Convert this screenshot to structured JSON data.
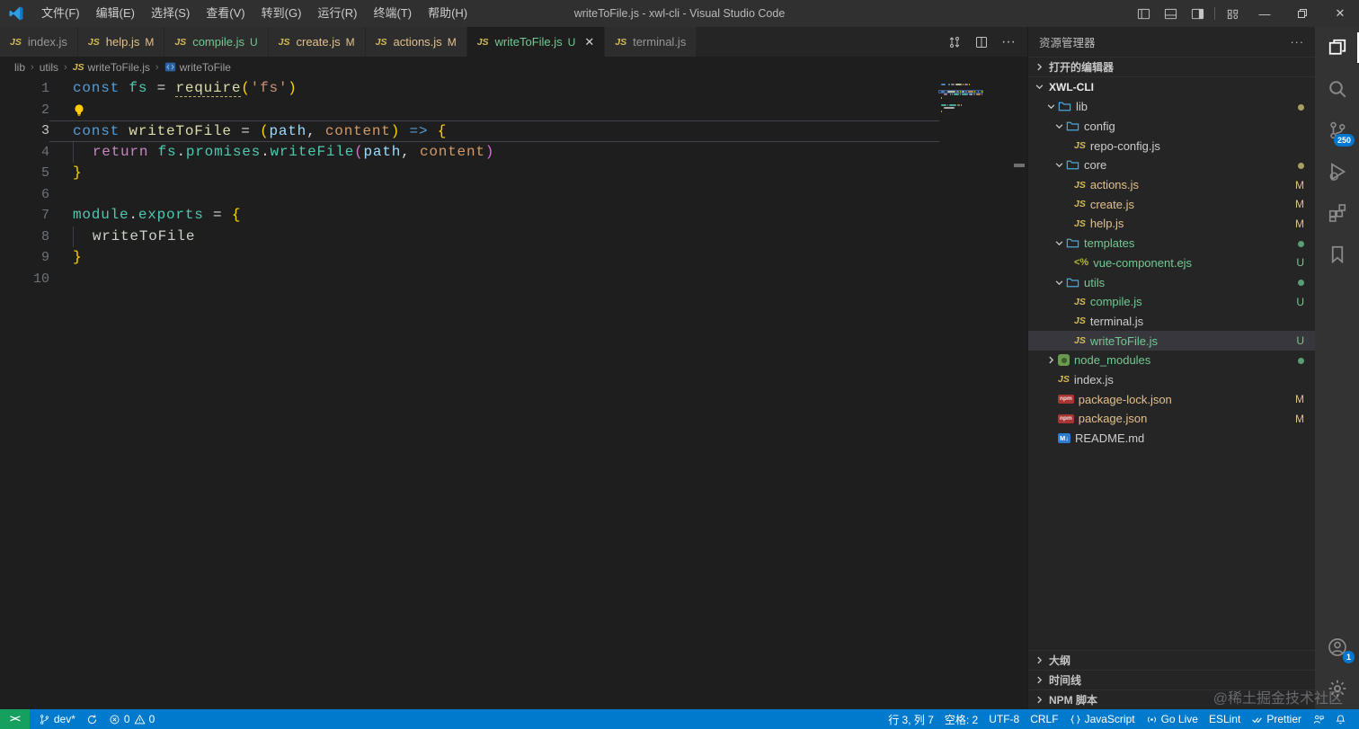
{
  "titlebar": {
    "title": "writeToFile.js - xwl-cli - Visual Studio Code",
    "menus": [
      "文件(F)",
      "编辑(E)",
      "选择(S)",
      "查看(V)",
      "转到(G)",
      "运行(R)",
      "终端(T)",
      "帮助(H)"
    ],
    "layout_icons": [
      "layout-sidebar-left-icon",
      "layout-panel-icon",
      "layout-sidebar-right-icon"
    ],
    "customize_icon": "customize-layout-icon",
    "window_buttons": [
      "minimize",
      "restore",
      "close"
    ]
  },
  "tabs": [
    {
      "label": "index.js",
      "badge": "",
      "state": "default",
      "active": false
    },
    {
      "label": "help.js",
      "badge": "M",
      "state": "modified",
      "active": false
    },
    {
      "label": "compile.js",
      "badge": "U",
      "state": "untracked",
      "active": false
    },
    {
      "label": "create.js",
      "badge": "M",
      "state": "modified",
      "active": false
    },
    {
      "label": "actions.js",
      "badge": "M",
      "state": "modified",
      "active": false
    },
    {
      "label": "writeToFile.js",
      "badge": "U",
      "state": "untracked",
      "active": true
    },
    {
      "label": "terminal.js",
      "badge": "",
      "state": "default",
      "active": false
    }
  ],
  "tab_actions": [
    "open-changes-icon",
    "split-editor-icon",
    "more-actions-icon"
  ],
  "breadcrumb": {
    "path": [
      "lib",
      "utils"
    ],
    "file": "writeToFile.js",
    "symbol": "writeToFile"
  },
  "editor": {
    "current_line": 3,
    "lightbulb_line": 2,
    "lines": [
      {
        "tokens": [
          [
            "const",
            "kw"
          ],
          [
            " ",
            "ws"
          ],
          [
            "fs",
            "var"
          ],
          [
            " = ",
            "op"
          ],
          [
            "require",
            "fnu"
          ],
          [
            "(",
            "b1"
          ],
          [
            "'fs'",
            "str"
          ],
          [
            ")",
            "b1"
          ]
        ]
      },
      {
        "tokens": []
      },
      {
        "tokens": [
          [
            "const",
            "kw"
          ],
          [
            " ",
            "ws"
          ],
          [
            "writeToFile",
            "fn"
          ],
          [
            " = ",
            "op"
          ],
          [
            "(",
            "b1"
          ],
          [
            "path",
            "p1"
          ],
          [
            ", ",
            "op"
          ],
          [
            "content",
            "p2"
          ],
          [
            ")",
            "b1"
          ],
          [
            " ",
            "ws"
          ],
          [
            "=>",
            "kw"
          ],
          [
            " ",
            "ws"
          ],
          [
            "{",
            "b1"
          ]
        ]
      },
      {
        "tokens": [
          [
            "  ",
            "ind"
          ],
          [
            "return",
            "ctrl"
          ],
          [
            " ",
            "ws"
          ],
          [
            "fs",
            "var"
          ],
          [
            ".",
            "op"
          ],
          [
            "promises",
            "var"
          ],
          [
            ".",
            "op"
          ],
          [
            "writeFile",
            "var"
          ],
          [
            "(",
            "b2"
          ],
          [
            "path",
            "p1"
          ],
          [
            ", ",
            "op"
          ],
          [
            "content",
            "p2"
          ],
          [
            ")",
            "b2"
          ]
        ]
      },
      {
        "tokens": [
          [
            "}",
            "b1"
          ]
        ]
      },
      {
        "tokens": []
      },
      {
        "tokens": [
          [
            "module",
            "var"
          ],
          [
            ".",
            "op"
          ],
          [
            "exports",
            "var"
          ],
          [
            " = ",
            "op"
          ],
          [
            "{",
            "b1"
          ]
        ]
      },
      {
        "tokens": [
          [
            "  ",
            "ind"
          ],
          [
            "writeToFile",
            "plain"
          ]
        ]
      },
      {
        "tokens": [
          [
            "}",
            "b1"
          ]
        ]
      },
      {
        "tokens": []
      }
    ]
  },
  "explorer": {
    "title": "资源管理器",
    "open_editors_label": "打开的编辑器",
    "project_label": "XWL-CLI",
    "tree": [
      {
        "name": "lib",
        "icon": "folder",
        "level": 1,
        "chevron": "down",
        "color": "default",
        "dot": "#a8a060"
      },
      {
        "name": "config",
        "icon": "folder",
        "level": 2,
        "chevron": "down",
        "color": "default"
      },
      {
        "name": "repo-config.js",
        "icon": "js",
        "level": 3,
        "color": "default"
      },
      {
        "name": "core",
        "icon": "folder",
        "level": 2,
        "chevron": "down",
        "color": "default",
        "dot": "#a8a060"
      },
      {
        "name": "actions.js",
        "icon": "js",
        "level": 3,
        "color": "mod",
        "badge": "M"
      },
      {
        "name": "create.js",
        "icon": "js",
        "level": 3,
        "color": "mod",
        "badge": "M"
      },
      {
        "name": "help.js",
        "icon": "js",
        "level": 3,
        "color": "mod",
        "badge": "M"
      },
      {
        "name": "templates",
        "icon": "folder",
        "level": 2,
        "chevron": "down",
        "color": "green",
        "dot": "#5a9e76"
      },
      {
        "name": "vue-component.ejs",
        "icon": "ejs",
        "level": 3,
        "color": "green",
        "badge": "U"
      },
      {
        "name": "utils",
        "icon": "folder",
        "level": 2,
        "chevron": "down",
        "color": "green",
        "dot": "#5a9e76"
      },
      {
        "name": "compile.js",
        "icon": "js",
        "level": 3,
        "color": "green",
        "badge": "U"
      },
      {
        "name": "terminal.js",
        "icon": "js",
        "level": 3,
        "color": "default"
      },
      {
        "name": "writeToFile.js",
        "icon": "js",
        "level": 3,
        "color": "green",
        "badge": "U",
        "selected": true
      },
      {
        "name": "node_modules",
        "icon": "node",
        "level": 1,
        "chevron": "right",
        "color": "green",
        "dot": "#5a9e76"
      },
      {
        "name": "index.js",
        "icon": "js",
        "level": 1,
        "color": "default"
      },
      {
        "name": "package-lock.json",
        "icon": "npm",
        "level": 1,
        "color": "mod",
        "badge": "M"
      },
      {
        "name": "package.json",
        "icon": "npm",
        "level": 1,
        "color": "mod",
        "badge": "M"
      },
      {
        "name": "README.md",
        "icon": "md",
        "level": 1,
        "color": "default"
      }
    ],
    "bottom_sections": [
      "大纲",
      "时间线",
      "NPM 脚本"
    ]
  },
  "activity_bar": {
    "top": [
      {
        "name": "explorer-icon",
        "active": true
      },
      {
        "name": "search-icon"
      },
      {
        "name": "source-control-icon",
        "badge": "250"
      },
      {
        "name": "run-debug-icon"
      },
      {
        "name": "extensions-icon"
      },
      {
        "name": "bookmarks-icon"
      }
    ],
    "bottom": [
      {
        "name": "account-icon",
        "badge": "1"
      },
      {
        "name": "settings-gear-icon"
      }
    ]
  },
  "status_bar": {
    "remote_glyph": "><",
    "left": [
      {
        "icon": "branch-icon",
        "label": "dev*"
      },
      {
        "icon": "sync-icon",
        "label": ""
      },
      {
        "icon": "error-icon",
        "label": "0",
        "icon2": "warning-icon",
        "label2": "0"
      }
    ],
    "right": [
      {
        "icon": "",
        "label": "行 3, 列 7"
      },
      {
        "icon": "",
        "label": "空格: 2"
      },
      {
        "icon": "",
        "label": "UTF-8"
      },
      {
        "icon": "",
        "label": "CRLF"
      },
      {
        "icon": "brackets-icon",
        "label": "JavaScript"
      },
      {
        "icon": "golive-icon",
        "label": "Go Live"
      },
      {
        "icon": "",
        "label": "ESLint"
      },
      {
        "icon": "prettier-icon",
        "label": "Prettier"
      },
      {
        "icon": "feedback-icon",
        "label": ""
      },
      {
        "icon": "bell-icon",
        "label": ""
      }
    ]
  },
  "watermark": "@稀土掘金技术社区",
  "colors": {
    "accent": "#007acc",
    "remote_green": "#16a05f",
    "git_untracked": "#73c991",
    "git_modified": "#e2c08d",
    "syntax": {
      "keyword": "#569cd6",
      "variable": "#4ec9b0",
      "function": "#dcdcaa",
      "string": "#ce9178",
      "bracket1": "#ffd700",
      "bracket2": "#da70d6",
      "param": "#9cdcfe",
      "param2": "#d19a66",
      "control": "#c586c0",
      "plain": "#d4d4d4"
    }
  }
}
